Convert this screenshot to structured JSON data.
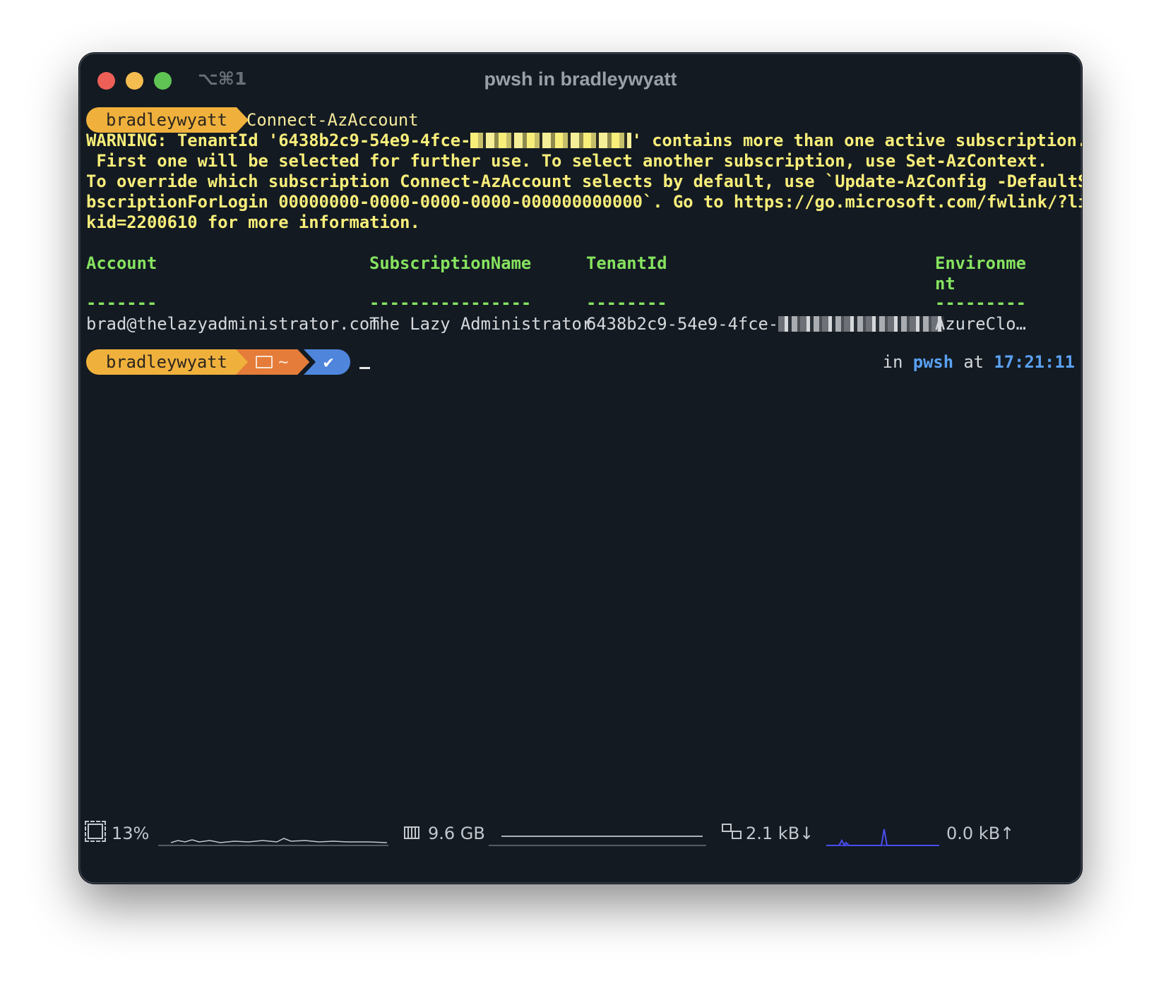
{
  "window": {
    "shortcut": "⌥⌘1",
    "title": "pwsh in bradleywyatt"
  },
  "prompt1": {
    "user": "bradleywyatt",
    "command": "Connect-AzAccount"
  },
  "warning": {
    "line1_a": "WARNING: TenantId '6438b2c9-54e9-4fce-",
    "line1_b": "' contains more than one active subscription.",
    "line2": " First one will be selected for further use. To select another subscription, use Set-AzContext.",
    "line3": "To override which subscription Connect-AzAccount selects by default, use `Update-AzConfig -DefaultSu",
    "line4": "bscriptionForLogin 00000000-0000-0000-0000-000000000000`. Go to https://go.microsoft.com/fwlink/?lin",
    "line5": "kid=2200610 for more information."
  },
  "table": {
    "headers": [
      "Account",
      "SubscriptionName",
      "TenantId",
      "Environme",
      "nt"
    ],
    "underlines": [
      "-------",
      "----------------",
      "--------",
      "---------"
    ],
    "row": {
      "account": "brad@thelazyadministrator.com",
      "subscription": "The Lazy Administrator",
      "tenant_prefix": "6438b2c9-54e9-4fce-",
      "environment": "AzureClo…"
    }
  },
  "prompt2": {
    "user": "bradleywyatt",
    "folder_icon": "folder-icon",
    "folder": "~",
    "status_icon": "check-icon",
    "right_in": "in",
    "shell": "pwsh",
    "right_at": "at",
    "time": "17:21:11",
    "shell_color": "#5aa1f2"
  },
  "status": {
    "cpu_icon": "cpu-icon",
    "cpu": "13%",
    "mem_icon": "memory-icon",
    "memory": "9.6 GB",
    "net_icon": "network-icon",
    "down": "2.1 kB↓",
    "up": "0.0 kB↑"
  }
}
